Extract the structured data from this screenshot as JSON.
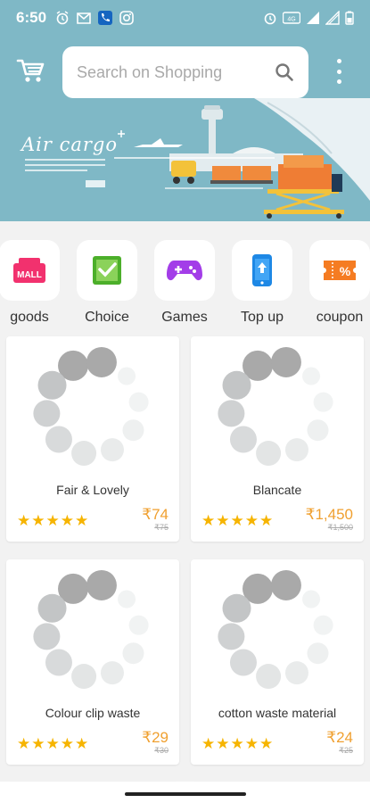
{
  "status_bar": {
    "time": "6:50",
    "left_icons": [
      "alarm-icon",
      "gmail-icon",
      "phone-icon",
      "instagram-icon"
    ],
    "right_icons": [
      "alarm-icon",
      "volte-icon",
      "signal-icon",
      "signal-icon",
      "battery-icon"
    ]
  },
  "header": {
    "search_placeholder": "Search on Shopping",
    "cart_icon": "cart-icon",
    "search_icon": "search-icon",
    "menu_icon": "more-vert-icon"
  },
  "banner": {
    "text": "Air cargo",
    "background": "#7fb8c6"
  },
  "categories": [
    {
      "label": "goods",
      "icon": "mall-icon"
    },
    {
      "label": "Choice",
      "icon": "choice-check-icon"
    },
    {
      "label": "Games",
      "icon": "gamepad-icon"
    },
    {
      "label": "Top up",
      "icon": "phone-topup-icon"
    },
    {
      "label": "coupon",
      "icon": "coupon-percent-icon"
    }
  ],
  "products": [
    {
      "name": "Fair & Lovely",
      "price": "₹74",
      "was": "₹75",
      "rating": 5
    },
    {
      "name": "Blancate",
      "price": "₹1,450",
      "was": "₹1,500",
      "rating": 5
    },
    {
      "name": "Colour clip waste",
      "price": "₹29",
      "was": "₹30",
      "rating": 5
    },
    {
      "name": "cotton waste material",
      "price": "₹24",
      "was": "₹25",
      "rating": 5
    }
  ],
  "colors": {
    "accent": "#f0a030",
    "star": "#f6b400",
    "header_bg": "#7fb8c6"
  }
}
